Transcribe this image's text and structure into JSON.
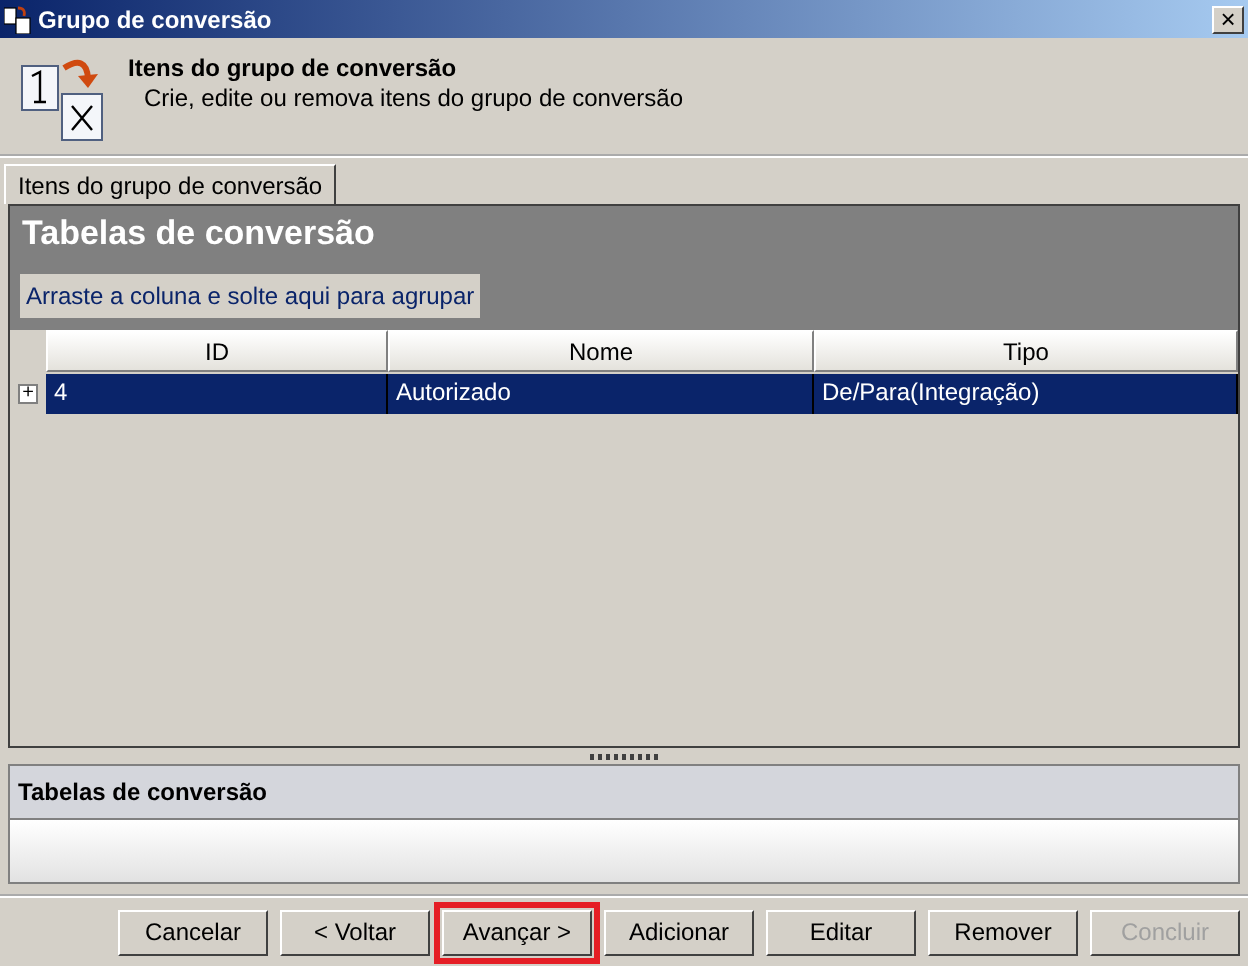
{
  "window": {
    "title": "Grupo de conversão",
    "close": "×"
  },
  "header": {
    "title": "Itens do grupo de conversão",
    "subtitle": "Crie, edite ou remova itens do grupo de conversão"
  },
  "tabs": [
    {
      "label": "Itens do grupo de conversão",
      "selected": true
    }
  ],
  "grid": {
    "title": "Tabelas de conversão",
    "group_hint": "Arraste a coluna e solte aqui para agrupar",
    "columns": [
      "ID",
      "Nome",
      "Tipo"
    ],
    "rows": [
      {
        "expand": "+",
        "cells": [
          "4",
          "Autorizado",
          "De/Para(Integração)"
        ],
        "selected": true
      }
    ]
  },
  "detail": {
    "title": "Tabelas de conversão"
  },
  "buttons": [
    {
      "label": "Cancelar",
      "disabled": false,
      "highlighted": false
    },
    {
      "label": "< Voltar",
      "disabled": false,
      "highlighted": false
    },
    {
      "label": "Avançar >",
      "disabled": false,
      "highlighted": true
    },
    {
      "label": "Adicionar",
      "disabled": false,
      "highlighted": false
    },
    {
      "label": "Editar",
      "disabled": false,
      "highlighted": false
    },
    {
      "label": "Remover",
      "disabled": false,
      "highlighted": false
    },
    {
      "label": "Concluir",
      "disabled": true,
      "highlighted": false
    }
  ]
}
